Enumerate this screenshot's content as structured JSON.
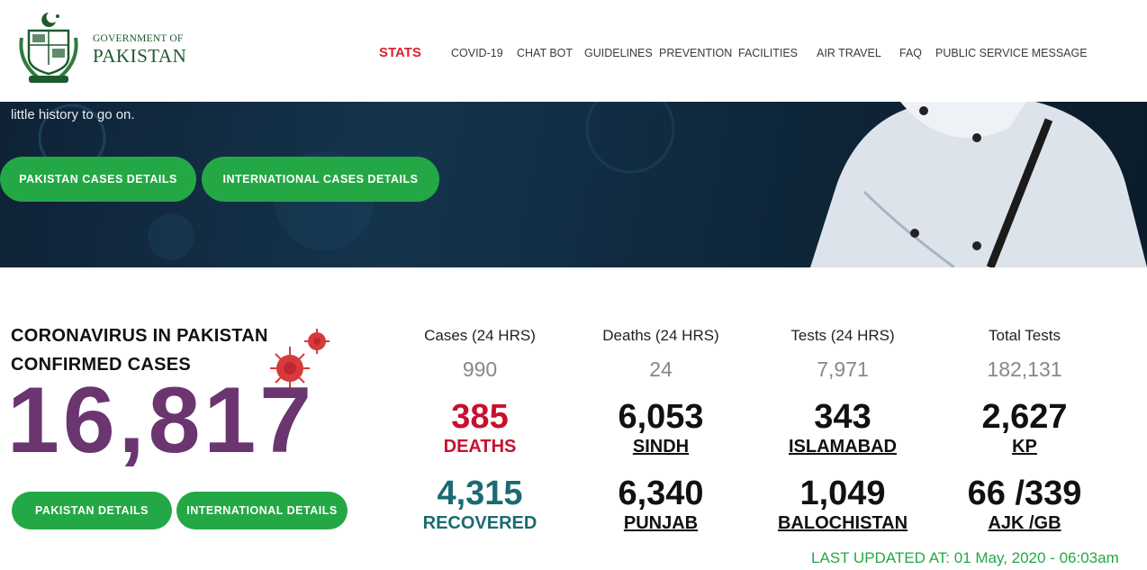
{
  "header": {
    "logo_line1": "GOVERNMENT OF",
    "logo_line2": "PAKISTAN",
    "nav": [
      "STATS",
      "COVID-19",
      "CHAT BOT",
      "GUIDELINES",
      "PREVENTION",
      "FACILITIES",
      "AIR TRAVEL",
      "FAQ",
      "PUBLIC SERVICE MESSAGE"
    ],
    "active": "STATS"
  },
  "hero": {
    "text": "little history to go on.",
    "btn_pakistan": "PAKISTAN CASES DETAILS",
    "btn_international": "INTERNATIONAL CASES DETAILS"
  },
  "summary": {
    "title_line1": "CORONAVIRUS IN PAKISTAN",
    "title_line2": "CONFIRMED CASES",
    "confirmed": "16,817",
    "btn_pakistan": "PAKISTAN DETAILS",
    "btn_international": "INTERNATIONAL DETAILS"
  },
  "stats24": [
    {
      "label": "Cases (24 HRS)",
      "value": "990"
    },
    {
      "label": "Deaths (24 HRS)",
      "value": "24"
    },
    {
      "label": "Tests (24 HRS)",
      "value": "7,971"
    },
    {
      "label": "Total Tests",
      "value": "182,131"
    }
  ],
  "deaths": {
    "value": "385",
    "label": "DEATHS"
  },
  "recovered": {
    "value": "4,315",
    "label": "RECOVERED"
  },
  "regions": [
    {
      "value": "6,053",
      "label": "SINDH"
    },
    {
      "value": "343",
      "label": "ISLAMABAD"
    },
    {
      "value": "2,627",
      "label": "KP"
    },
    {
      "value": "6,340",
      "label": "PUNJAB"
    },
    {
      "value": "1,049",
      "label": "BALOCHISTAN"
    },
    {
      "value": "66 /339",
      "label": "AJK /GB"
    }
  ],
  "updated": "LAST UPDATED AT: 01 May, 2020 - 06:03am",
  "colors": {
    "green": "#23a845",
    "red": "#c8102e",
    "purple": "#6b3570",
    "teal": "#1b6b73",
    "nav_active": "#d9232e"
  }
}
